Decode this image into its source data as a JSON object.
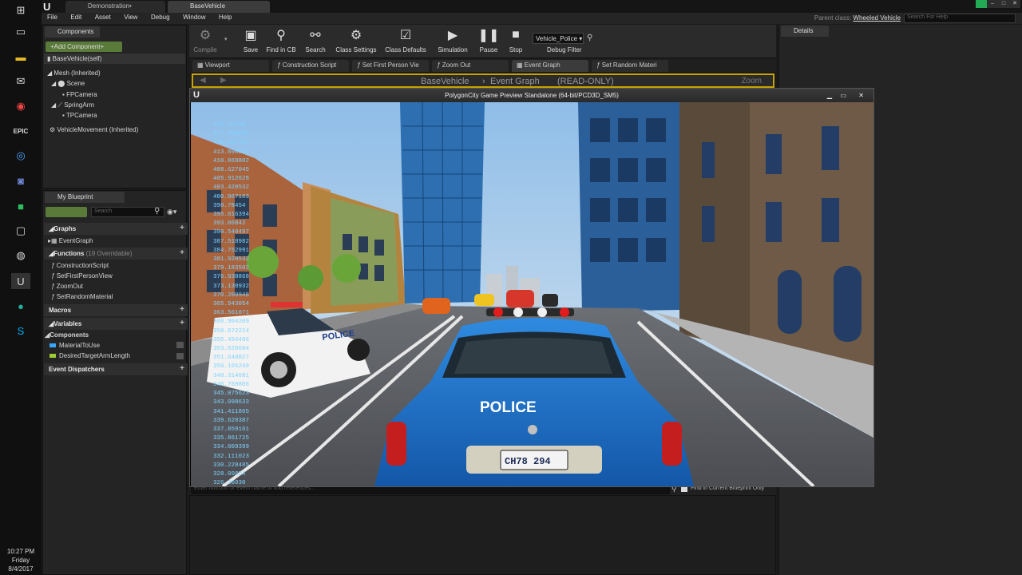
{
  "taskbar": {
    "icons": [
      "windows-start-icon",
      "task-view-icon",
      "file-explorer-icon",
      "mail-icon",
      "chrome-icon",
      "epic-launcher-icon",
      "unreal-icon",
      "discord-icon",
      "evernote-icon",
      "oculus-icon",
      "steam-icon",
      "unreal-engine-icon",
      "app-icon",
      "skype-icon"
    ],
    "clock": {
      "time": "10:27 PM",
      "day": "Friday",
      "date": "8/4/2017"
    }
  },
  "titlebar": {
    "tabs": [
      {
        "label": "Demonstration•"
      },
      {
        "label": "BaseVehicle"
      }
    ]
  },
  "menubar": {
    "items": [
      "File",
      "Edit",
      "Asset",
      "View",
      "Debug",
      "Window",
      "Help"
    ],
    "parent_class_label": "Parent class:",
    "parent_class_value": "Wheeled Vehicle",
    "help_search_placeholder": "Search For Help"
  },
  "components_panel": {
    "tab": "Components",
    "add_button": "+Add Component+",
    "tree": [
      "BaseVehicle(self)",
      "Mesh (Inherited)",
      "Scene",
      "FPCamera",
      "SpringArm",
      "TPCamera",
      "VehicleMovement (Inherited)"
    ]
  },
  "my_blueprint_panel": {
    "tab": "My Blueprint",
    "search_placeholder": "Search",
    "graphs_label": "Graphs",
    "graphs": [
      "EventGraph"
    ],
    "functions_label": "Functions",
    "functions_count": "(19 Overridable)",
    "functions": [
      "ConstructionScript",
      "SetFirstPersonView",
      "ZoomOut",
      "SetRandomMaterial"
    ],
    "macros_label": "Macros",
    "variables_label": "Variables",
    "components_label": "Components",
    "variables": [
      {
        "name": "MaterialToUse",
        "color": "#3aa7ff"
      },
      {
        "name": "DesiredTargetArmLength",
        "color": "#9acd32"
      }
    ],
    "dispatchers_label": "Event Dispatchers"
  },
  "toolbar": {
    "buttons": [
      {
        "label": "Compile",
        "icon": "compile-icon"
      },
      {
        "label": "Save",
        "icon": "save-icon"
      },
      {
        "label": "Find in CB",
        "icon": "find-in-cb-icon"
      },
      {
        "label": "Search",
        "icon": "search-icon"
      },
      {
        "label": "Class Settings",
        "icon": "class-settings-icon"
      },
      {
        "label": "Class Defaults",
        "icon": "class-defaults-icon"
      },
      {
        "label": "Simulation",
        "icon": "simulation-icon"
      },
      {
        "label": "Pause",
        "icon": "pause-icon"
      },
      {
        "label": "Stop",
        "icon": "stop-icon"
      }
    ],
    "debug_dropdown": "Vehicle_Police",
    "debug_filter_label": "Debug Filter"
  },
  "graph_tabs": [
    "Viewport",
    "Construction Script",
    "Set First Person Vie",
    "Zoom Out",
    "Event Graph",
    "Set Random Materi"
  ],
  "graph_breadcrumb": {
    "root": "BaseVehicle",
    "graph": "Event Graph",
    "mode": "(READ-ONLY)",
    "zoom": "Zoom"
  },
  "game_window": {
    "title": "PolygonCity Game Preview Standalone (64-bit/PCD3D_SM5)",
    "license_plate": "CH78 294",
    "police_label": "POLICE",
    "debug_values": [
      "419.91150",
      "417.800883",
      "415.267446",
      "413.090057",
      "410.869802",
      "408.627045",
      "405.912628",
      "403.420532",
      "400.967163",
      "398.78454",
      "395.616394",
      "393.06842",
      "390.540497",
      "387.518982",
      "384.752991",
      "381.920532",
      "379.183502",
      "376.938868",
      "373.138932",
      "370.200948",
      "365.943054",
      "363.561071",
      "360.904309",
      "358.072224",
      "355.454486",
      "353.620684",
      "351.640827",
      "350.165249",
      "348.314681",
      "346.769806",
      "345.075623",
      "343.098633",
      "341.411865",
      "339.628387",
      "337.859161",
      "335.861725",
      "334.009399",
      "332.111023",
      "330.228485",
      "328.00824",
      "326.26030"
    ]
  },
  "find_results": {
    "placeholder": "Enter function or event name to find references...",
    "checkbox_label": "Find in Current Blueprint Only"
  },
  "details_panel": {
    "tab": "Details"
  }
}
